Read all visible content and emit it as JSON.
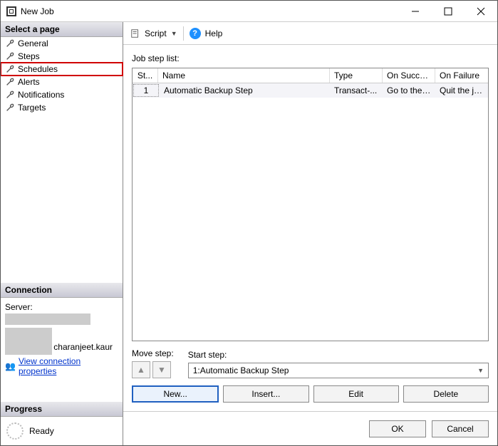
{
  "window": {
    "title": "New Job"
  },
  "sidebar": {
    "select_header": "Select a page",
    "pages": [
      {
        "label": "General"
      },
      {
        "label": "Steps"
      },
      {
        "label": "Schedules",
        "highlight": true
      },
      {
        "label": "Alerts"
      },
      {
        "label": "Notifications"
      },
      {
        "label": "Targets"
      }
    ],
    "connection": {
      "header": "Connection",
      "server_label": "Server:",
      "user_suffix": "charanjeet.kaur",
      "link": "View connection properties"
    },
    "progress": {
      "header": "Progress",
      "status": "Ready"
    }
  },
  "toolbar": {
    "script": "Script",
    "help": "Help"
  },
  "main": {
    "list_label": "Job step list:",
    "columns": {
      "st": "St...",
      "name": "Name",
      "type": "Type",
      "success": "On Success",
      "failure": "On Failure"
    },
    "rows": [
      {
        "st": "1",
        "name": "Automatic Backup Step",
        "type": "Transact-...",
        "success": "Go to the ...",
        "failure": "Quit the jo..."
      }
    ],
    "move_label": "Move step:",
    "start_label": "Start step:",
    "start_value": "1:Automatic Backup Step",
    "buttons": {
      "new": "New...",
      "insert": "Insert...",
      "edit": "Edit",
      "delete": "Delete"
    }
  },
  "footer": {
    "ok": "OK",
    "cancel": "Cancel"
  }
}
